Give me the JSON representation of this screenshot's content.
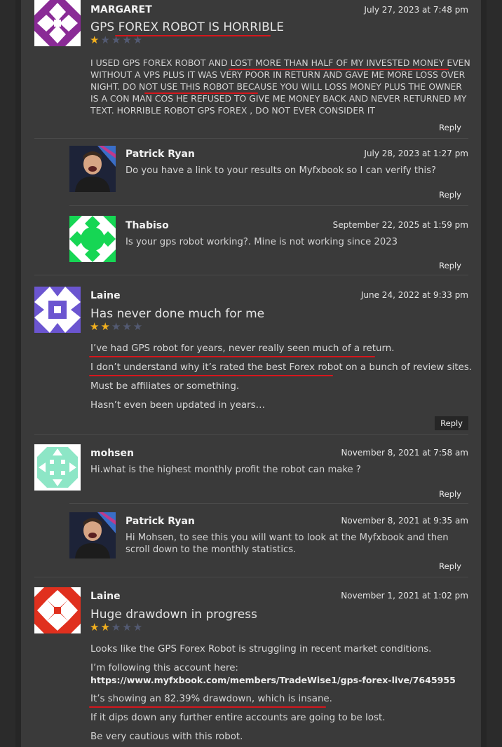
{
  "comments": [
    {
      "author": "MARGARET",
      "date": "July 27, 2023 at 7:48 pm",
      "title": "GPS FOREX ROBOT IS HORRIBLE",
      "rating": 1,
      "body": "I USED GPS FOREX ROBOT AND LOST MORE THAN HALF OF MY INVESTED MONEY EVEN WITHOUT A VPS PLUS IT WAS VERY POOR IN RETURN AND GAVE ME MORE LOSS OVER NIGHT. DO NOT USE THIS ROBOT BECAUSE YOU WILL LOSS MONEY PLUS THE OWNER IS A CON MAN COS HE REFUSED TO GIVE ME MONEY BACK AND NEVER RETURNED MY TEXT. HORRIBLE ROBOT GPS FOREX , DO NOT EVER CONSIDER IT",
      "reply_label": "Reply"
    },
    {
      "author": "Patrick Ryan",
      "date": "July 28, 2023 at 1:27 pm",
      "body": "Do you have a link to your results on Myfxbook so I can verify this?",
      "reply_label": "Reply"
    },
    {
      "author": "Thabiso",
      "date": "September 22, 2025 at 1:59 pm",
      "body": "Is your gps robot working?. Mine is not working since 2023",
      "reply_label": "Reply"
    },
    {
      "author": "Laine",
      "date": "June 24, 2022 at 9:33 pm",
      "title": "Has never done much for me",
      "rating": 2,
      "paragraphs": [
        "I’ve had GPS robot for years, never really seen much of a return.",
        "I don’t understand why it’s rated the best Forex robot on a bunch of review sites.",
        "Must be affiliates or something.",
        "Hasn’t even been updated in years…"
      ],
      "reply_label": "Reply"
    },
    {
      "author": "mohsen",
      "date": "November 8, 2021 at 7:58 am",
      "body": "Hi.what is the highest monthly profit the robot can make ?",
      "reply_label": "Reply"
    },
    {
      "author": "Patrick Ryan",
      "date": "November 8, 2021 at 9:35 am",
      "body": "Hi Mohsen, to see this you will want to look at the Myfxbook and then scroll down to the monthly statistics.",
      "reply_label": "Reply"
    },
    {
      "author": "Laine",
      "date": "November 1, 2021 at 1:02 pm",
      "title": "Huge drawdown in progress",
      "rating": 2,
      "paragraphs": [
        "Looks like the GPS Forex Robot is struggling in recent market conditions.",
        "I’m following this account here:",
        "https://www.myfxbook.com/members/TradeWise1/gps-forex-live/7645955",
        "It’s showing an 82.39% drawdown, which is insane.",
        "If it dips down any further entire accounts are going to be lost.",
        "Be very cautious with this robot."
      ]
    }
  ],
  "colors": {
    "star_on": "#f2b01e",
    "star_off": "#535a72",
    "highlight": "#d6161c"
  }
}
